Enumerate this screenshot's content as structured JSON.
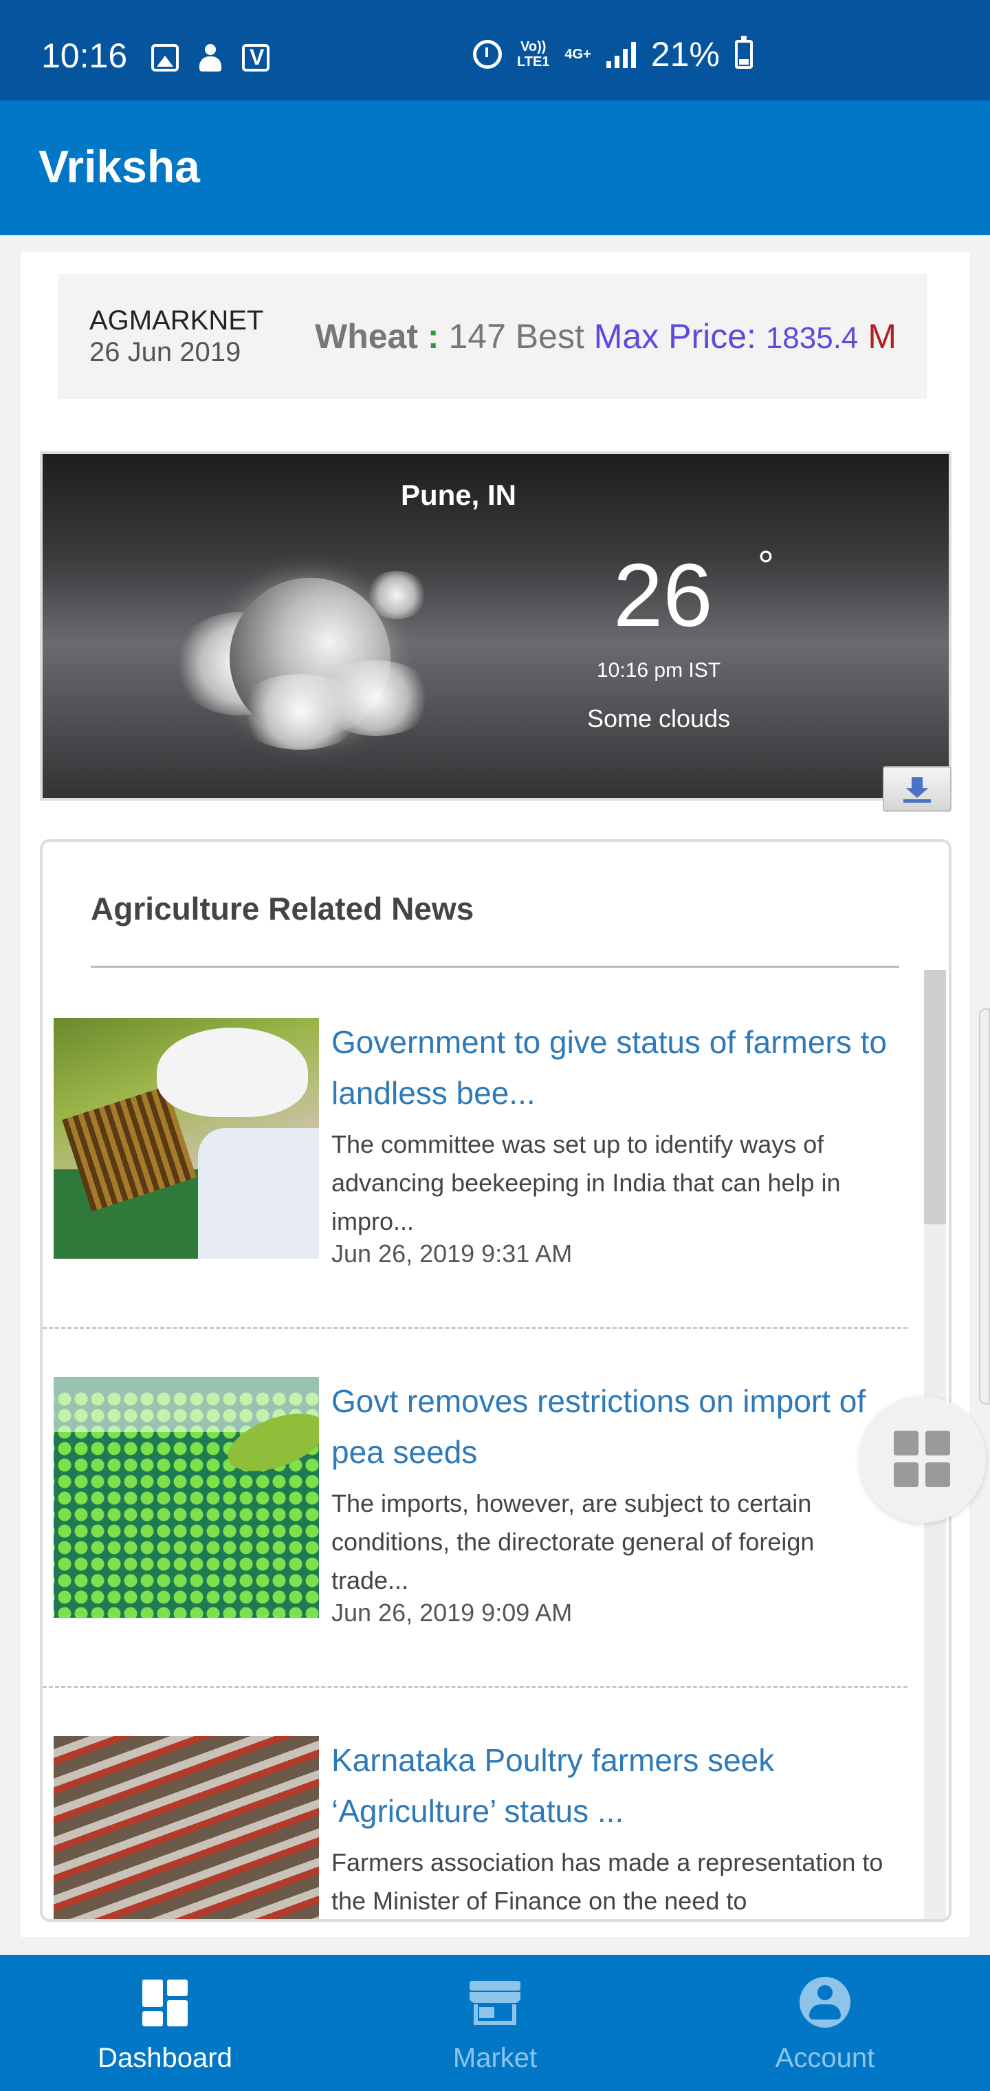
{
  "status_bar": {
    "time": "10:16",
    "network_top": "Vo))",
    "network_bottom": "LTE1",
    "network_type": "4G+",
    "battery": "21%",
    "icons": [
      "image-icon",
      "person-icon",
      "app-v-icon",
      "alarm-icon",
      "signal-icon",
      "battery-icon"
    ]
  },
  "app_bar": {
    "title": "Vriksha"
  },
  "ticker": {
    "source": "AGMARKNET",
    "date": "26 Jun 2019",
    "crop": "Wheat",
    "colon": ":",
    "count": "147 Best",
    "max_label": "Max Price:",
    "max_value": "1835.4",
    "next": "M"
  },
  "weather": {
    "city": "Pune, IN",
    "temperature": "26",
    "degree": "°",
    "time": "10:16 pm IST",
    "description": "Some clouds",
    "icon": "night-cloudy-icon"
  },
  "news": {
    "heading": "Agriculture Related News",
    "items": [
      {
        "title": "Government to give status of farmers to landless bee...",
        "description": "The committee was set up to identify ways of advancing beekeeping in India that can help in impro...",
        "date": "Jun 26, 2019 9:31 AM"
      },
      {
        "title": "Govt removes restrictions on import of pea seeds",
        "description": "The imports, however, are subject to certain conditions, the directorate general of foreign trade...",
        "date": "Jun 26, 2019 9:09 AM"
      },
      {
        "title": "Karnataka Poultry farmers seek ‘Agriculture’ status ...",
        "description": "Farmers association has made a representation to the Minister of Finance on the need to",
        "date": ""
      }
    ]
  },
  "bottom_nav": {
    "items": [
      {
        "label": "Dashboard",
        "icon": "dashboard-icon",
        "active": true
      },
      {
        "label": "Market",
        "icon": "store-icon",
        "active": false
      },
      {
        "label": "Account",
        "icon": "account-icon",
        "active": false
      }
    ]
  },
  "colors": {
    "status_bar": "#06549e",
    "primary": "#0277c5",
    "news_link": "#2e7ab8",
    "nav_inactive": "#8ec3ea"
  }
}
